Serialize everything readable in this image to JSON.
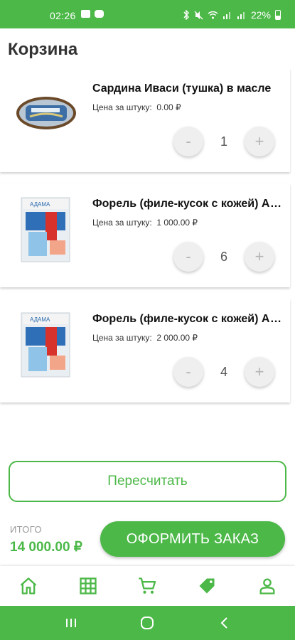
{
  "status_bar": {
    "time": "02:26",
    "battery": "22%"
  },
  "header": {
    "title": "Корзина"
  },
  "cart": {
    "items": [
      {
        "name": "Сардина Иваси (тушка) в масле",
        "price_label": "Цена за штуку:",
        "price": "0.00 ₽",
        "quantity": "1",
        "minus": "-",
        "plus": "+"
      },
      {
        "name": "Форель (филе-кусок с кожей) АДАМА",
        "price_label": "Цена за штуку:",
        "price": "1 000.00 ₽",
        "quantity": "6",
        "minus": "-",
        "plus": "+"
      },
      {
        "name": "Форель (филе-кусок с кожей) АДАМА",
        "price_label": "Цена за штуку:",
        "price": "2 000.00 ₽",
        "quantity": "4",
        "minus": "-",
        "plus": "+"
      }
    ]
  },
  "actions": {
    "recalc_label": "Пересчитать",
    "order_label": "ОФОРМИТЬ ЗАКАЗ"
  },
  "summary": {
    "total_label": "ИТОГО",
    "total_value": "14 000.00 ₽"
  },
  "bottom_nav": {
    "items": [
      {
        "icon": "home-icon"
      },
      {
        "icon": "catalog-grid-icon"
      },
      {
        "icon": "cart-icon"
      },
      {
        "icon": "tag-icon"
      },
      {
        "icon": "profile-icon"
      }
    ]
  },
  "colors": {
    "accent": "#4cb848",
    "accent_text": "#ffffff",
    "muted": "#999999"
  }
}
